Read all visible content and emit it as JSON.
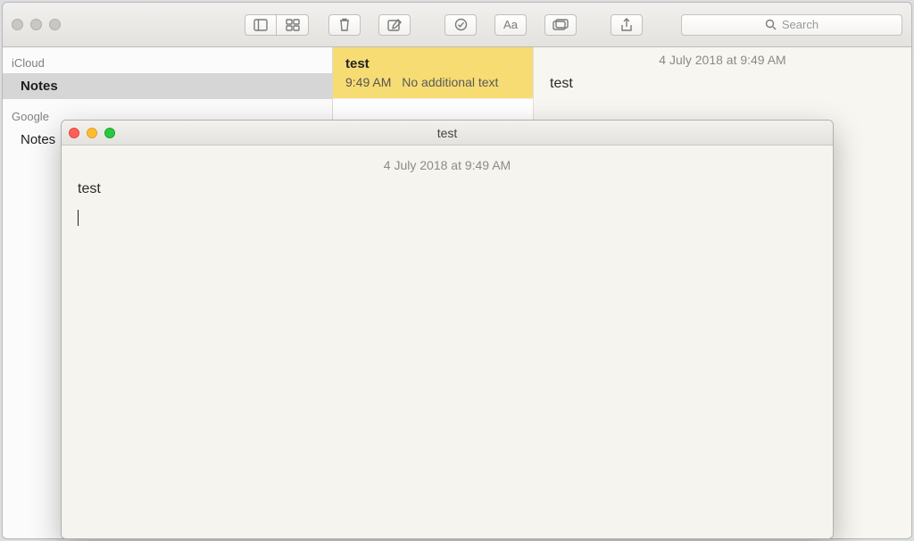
{
  "toolbar": {
    "search_placeholder": "Search"
  },
  "sidebar": {
    "sections": [
      {
        "header": "iCloud",
        "items": [
          {
            "label": "Notes",
            "selected": true
          }
        ]
      },
      {
        "header": "Google",
        "items": [
          {
            "label": "Notes",
            "selected": false
          }
        ]
      }
    ]
  },
  "notelist": {
    "items": [
      {
        "title": "test",
        "time": "9:49 AM",
        "preview": "No additional text",
        "selected": true
      }
    ]
  },
  "editor": {
    "timestamp": "4 July 2018 at 9:49 AM",
    "content": "test"
  },
  "float_window": {
    "title": "test",
    "timestamp": "4 July 2018 at 9:49 AM",
    "content": "test"
  }
}
